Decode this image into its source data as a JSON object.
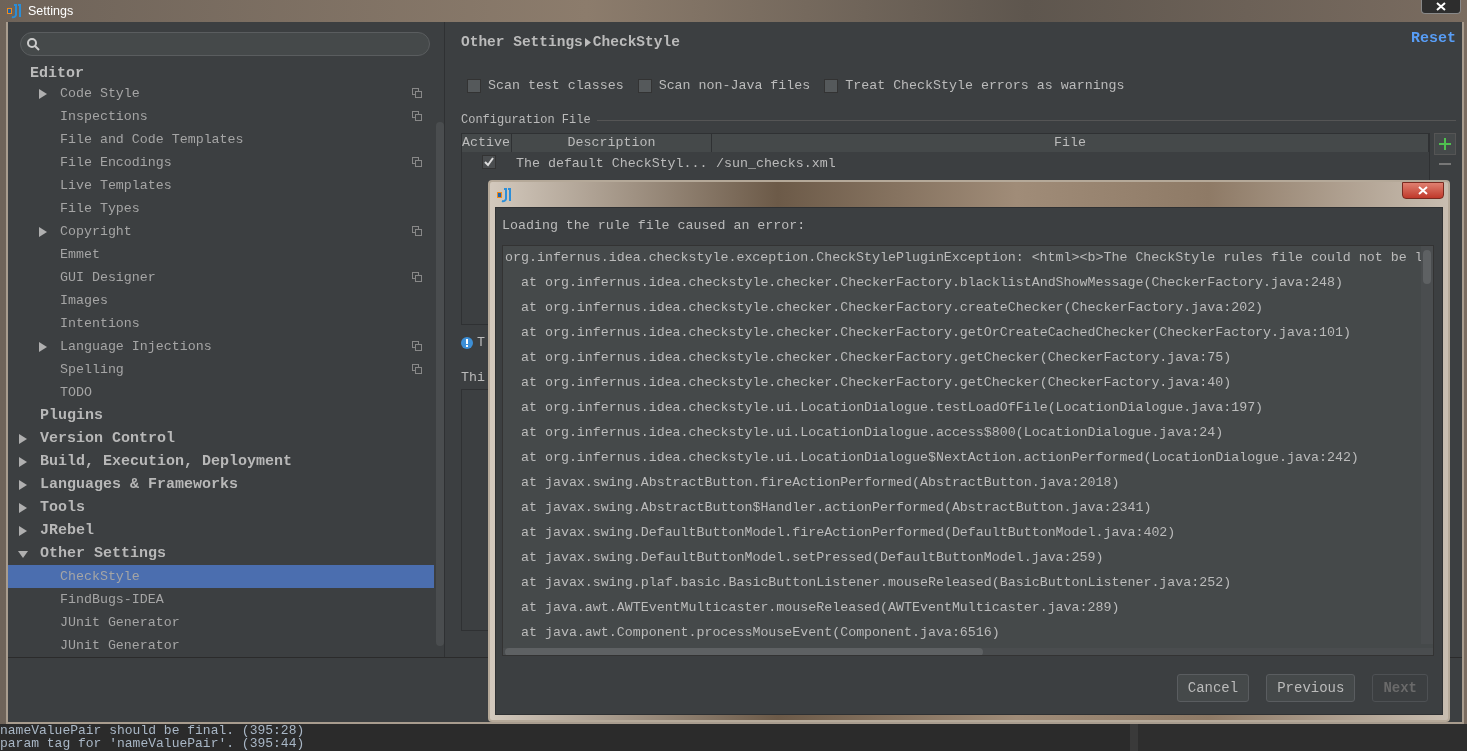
{
  "window": {
    "title": "Settings"
  },
  "sidebar": {
    "items": [
      {
        "label": "Editor",
        "kind": "section",
        "selected": false,
        "project_icon": false,
        "children": [
          {
            "label": "Code Style",
            "kind": "folder",
            "expanded": false,
            "selected": false,
            "project_icon": true
          },
          {
            "label": "Inspections",
            "kind": "page",
            "selected": false,
            "project_icon": true
          },
          {
            "label": "File and Code Templates",
            "kind": "page",
            "selected": false,
            "project_icon": false
          },
          {
            "label": "File Encodings",
            "kind": "page",
            "selected": false,
            "project_icon": true
          },
          {
            "label": "Live Templates",
            "kind": "page",
            "selected": false,
            "project_icon": false
          },
          {
            "label": "File Types",
            "kind": "page",
            "selected": false,
            "project_icon": false
          },
          {
            "label": "Copyright",
            "kind": "folder",
            "expanded": false,
            "selected": false,
            "project_icon": true
          },
          {
            "label": "Emmet",
            "kind": "page",
            "selected": false,
            "project_icon": false
          },
          {
            "label": "GUI Designer",
            "kind": "page",
            "selected": false,
            "project_icon": true
          },
          {
            "label": "Images",
            "kind": "page",
            "selected": false,
            "project_icon": false
          },
          {
            "label": "Intentions",
            "kind": "page",
            "selected": false,
            "project_icon": false
          },
          {
            "label": "Language Injections",
            "kind": "folder",
            "expanded": false,
            "selected": false,
            "project_icon": true
          },
          {
            "label": "Spelling",
            "kind": "page",
            "selected": false,
            "project_icon": true
          },
          {
            "label": "TODO",
            "kind": "page",
            "selected": false,
            "project_icon": false
          }
        ]
      },
      {
        "label": "Plugins",
        "kind": "page",
        "selected": false,
        "project_icon": false
      },
      {
        "label": "Version Control",
        "kind": "folder",
        "expanded": false,
        "selected": false,
        "project_icon": false
      },
      {
        "label": "Build, Execution, Deployment",
        "kind": "folder",
        "expanded": false,
        "selected": false,
        "project_icon": false
      },
      {
        "label": "Languages & Frameworks",
        "kind": "folder",
        "expanded": false,
        "selected": false,
        "project_icon": false
      },
      {
        "label": "Tools",
        "kind": "folder",
        "expanded": false,
        "selected": false,
        "project_icon": false
      },
      {
        "label": "JRebel",
        "kind": "folder",
        "expanded": false,
        "selected": false,
        "project_icon": false
      },
      {
        "label": "Other Settings",
        "kind": "folder",
        "expanded": true,
        "selected": false,
        "project_icon": false,
        "children": [
          {
            "label": "CheckStyle",
            "kind": "page",
            "selected": true,
            "project_icon": false
          },
          {
            "label": "FindBugs-IDEA",
            "kind": "page",
            "selected": false,
            "project_icon": false
          },
          {
            "label": "JUnit Generator",
            "kind": "page",
            "selected": false,
            "project_icon": false
          },
          {
            "label": "JUnit Generator",
            "kind": "page",
            "selected": false,
            "project_icon": false
          }
        ]
      }
    ]
  },
  "content": {
    "breadcrumb": [
      "Other Settings",
      "CheckStyle"
    ],
    "reset": "Reset",
    "options": [
      {
        "label": "Scan test classes",
        "checked": false
      },
      {
        "label": "Scan non-Java files",
        "checked": false
      },
      {
        "label": "Treat CheckStyle errors as warnings",
        "checked": false
      }
    ],
    "config_group": "Configuration File",
    "table": {
      "columns": [
        "Active",
        "Description",
        "File"
      ],
      "rows": [
        {
          "active": true,
          "description": "The default CheckStyl...",
          "file": "/sun_checks.xml"
        }
      ]
    },
    "info_text": "T",
    "third_party_label": "Thi"
  },
  "dialog": {
    "message": "Loading the rule file caused an error:",
    "exception": "org.infernus.idea.checkstyle.exception.CheckStylePluginException: <html><b>The CheckStyle rules file could not be l",
    "stack": [
      "at org.infernus.idea.checkstyle.checker.CheckerFactory.blacklistAndShowMessage(CheckerFactory.java:248)",
      "at org.infernus.idea.checkstyle.checker.CheckerFactory.createChecker(CheckerFactory.java:202)",
      "at org.infernus.idea.checkstyle.checker.CheckerFactory.getOrCreateCachedChecker(CheckerFactory.java:101)",
      "at org.infernus.idea.checkstyle.checker.CheckerFactory.getChecker(CheckerFactory.java:75)",
      "at org.infernus.idea.checkstyle.checker.CheckerFactory.getChecker(CheckerFactory.java:40)",
      "at org.infernus.idea.checkstyle.ui.LocationDialogue.testLoadOfFile(LocationDialogue.java:197)",
      "at org.infernus.idea.checkstyle.ui.LocationDialogue.access$800(LocationDialogue.java:24)",
      "at org.infernus.idea.checkstyle.ui.LocationDialogue$NextAction.actionPerformed(LocationDialogue.java:242)",
      "at javax.swing.AbstractButton.fireActionPerformed(AbstractButton.java:2018)",
      "at javax.swing.AbstractButton$Handler.actionPerformed(AbstractButton.java:2341)",
      "at javax.swing.DefaultButtonModel.fireActionPerformed(DefaultButtonModel.java:402)",
      "at javax.swing.DefaultButtonModel.setPressed(DefaultButtonModel.java:259)",
      "at javax.swing.plaf.basic.BasicButtonListener.mouseReleased(BasicButtonListener.java:252)",
      "at java.awt.AWTEventMulticaster.mouseReleased(AWTEventMulticaster.java:289)",
      "at java.awt.Component.processMouseEvent(Component.java:6516)"
    ],
    "buttons": [
      {
        "label": "Cancel",
        "disabled": false
      },
      {
        "label": "Previous",
        "disabled": false
      },
      {
        "label": "Next",
        "disabled": true
      }
    ]
  },
  "editor_lines": [
    "nameValuePair should be final. (395:28)",
    "param tag for 'nameValuePair'. (395:44)"
  ]
}
